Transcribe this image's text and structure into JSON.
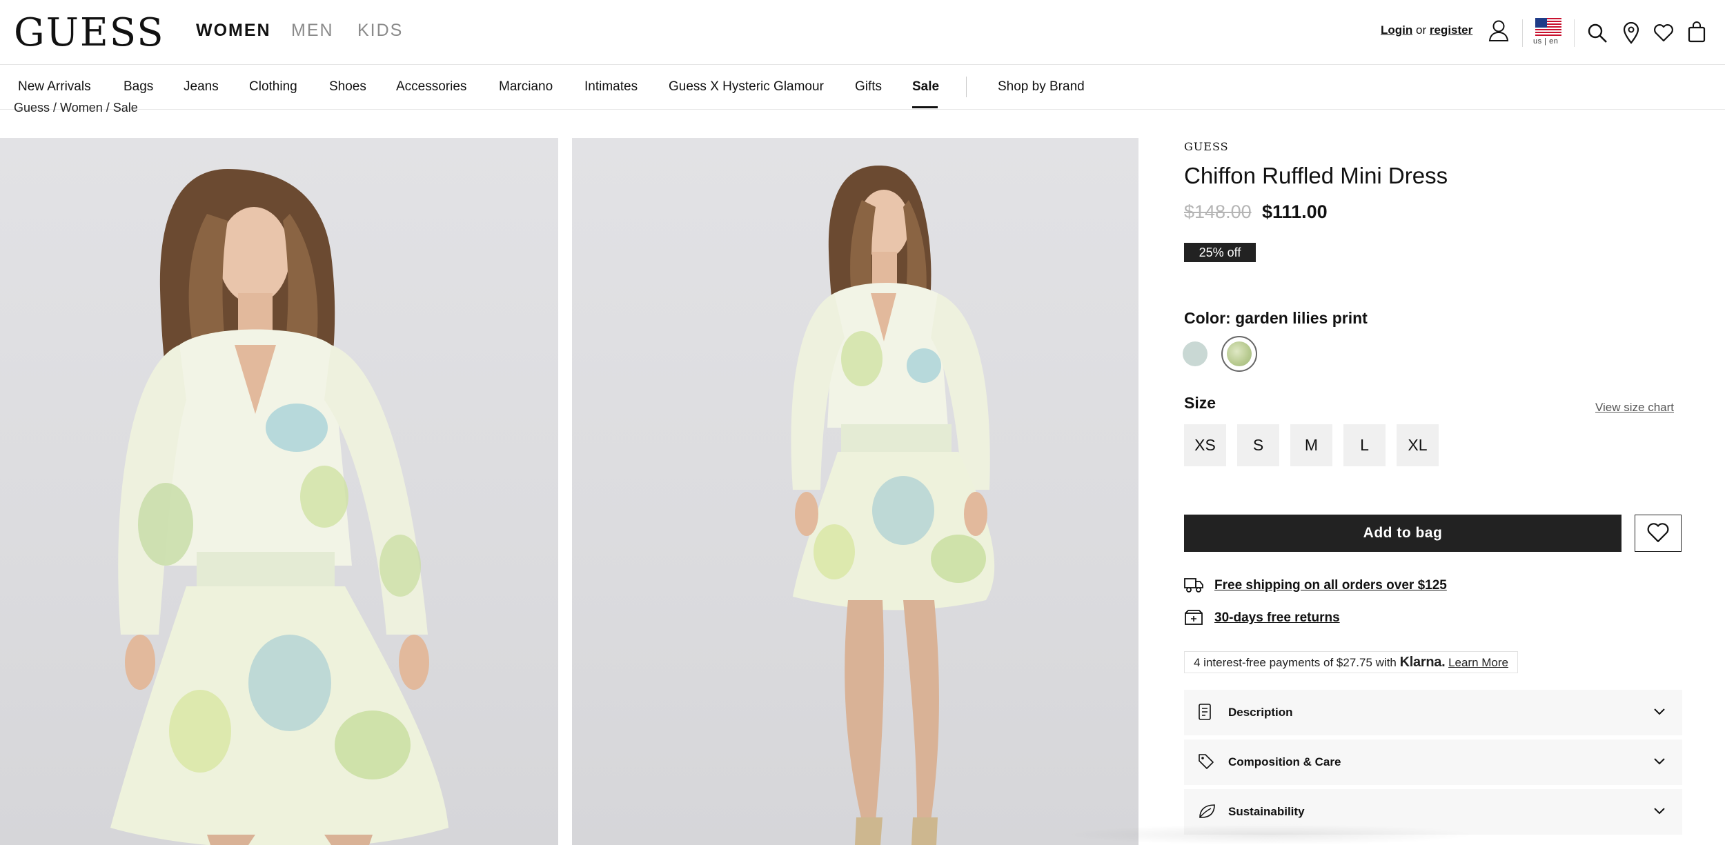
{
  "header": {
    "logo": "GUESS",
    "genders": [
      "WOMEN",
      "MEN",
      "KIDS"
    ],
    "account": {
      "login": "Login",
      "or": "or",
      "register": "register"
    },
    "locale": "us | en"
  },
  "categories": [
    "New Arrivals",
    "Bags",
    "Jeans",
    "Clothing",
    "Shoes",
    "Accessories",
    "Marciano",
    "Intimates",
    "Guess X Hysteric Glamour",
    "Gifts",
    "Sale"
  ],
  "shop_by_brand": "Shop by Brand",
  "breadcrumb": "Guess / Women / Sale",
  "product": {
    "brand": "GUESS",
    "title": "Chiffon Ruffled Mini Dress",
    "price_original": "$148.00",
    "price_sale": "$111.00",
    "discount": "25% off",
    "color_label": "Color: garden lilies print",
    "size_title": "Size",
    "size_chart": "View size chart",
    "sizes": [
      "XS",
      "S",
      "M",
      "L",
      "XL"
    ],
    "add_to_bag": "Add to bag",
    "shipping": "Free shipping on all orders over $125",
    "returns": "30-days free returns",
    "klarna": {
      "text": "4 interest-free payments of $27.75 with",
      "brand": "Klarna.",
      "link": "Learn More"
    },
    "accordions": [
      "Description",
      "Composition & Care",
      "Sustainability"
    ]
  },
  "colors": {
    "accent": "#222222",
    "swatch_mint": "#c9d8d4",
    "swatch_print": "#c7d3a2"
  }
}
